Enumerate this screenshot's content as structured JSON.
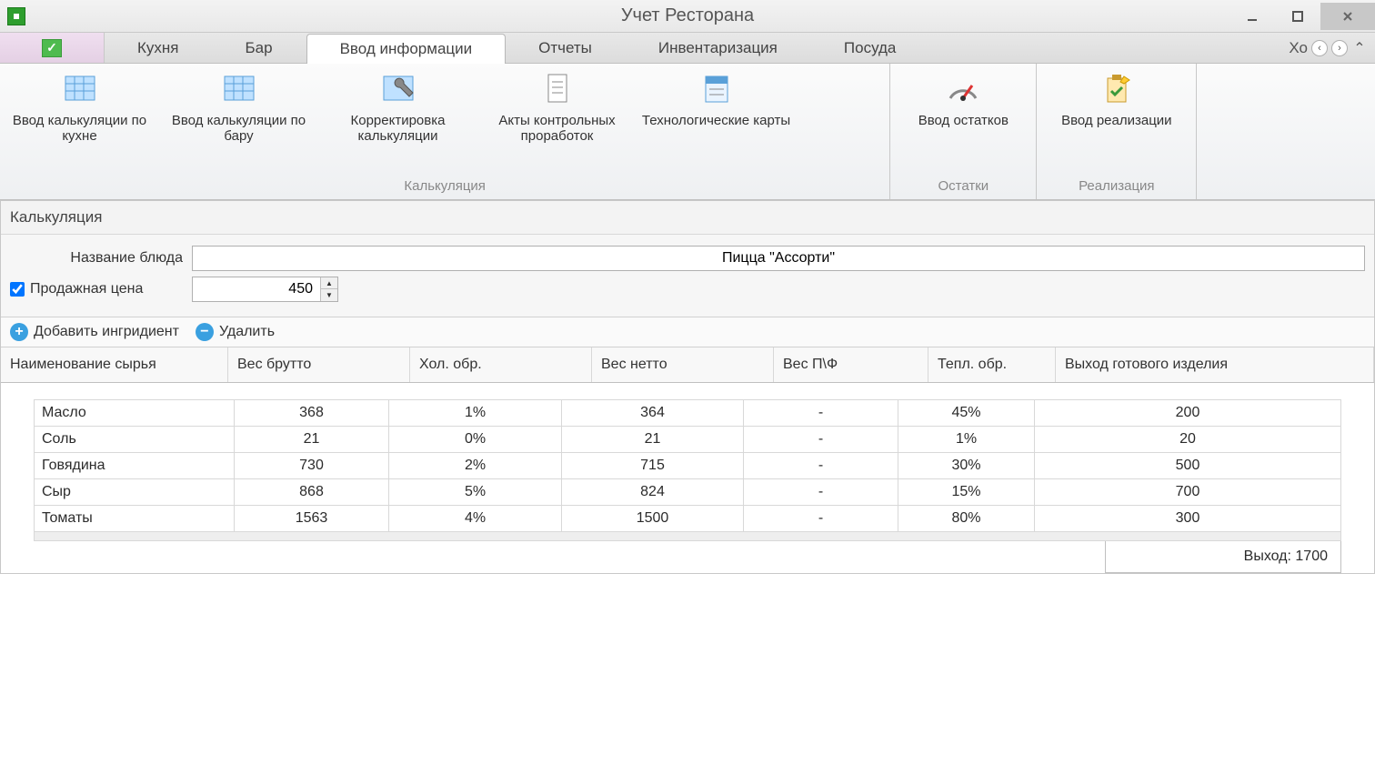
{
  "window": {
    "title": "Учет Ресторана"
  },
  "tabs": {
    "items": [
      "Кухня",
      "Бар",
      "Ввод информации",
      "Отчеты",
      "Инвентаризация",
      "Посуда"
    ],
    "overflow": "Хо"
  },
  "ribbon": {
    "group1": {
      "label": "Калькуляция",
      "items": [
        "Ввод калькуляции по кухне",
        "Ввод калькуляции по бару",
        "Корректировка калькуляции",
        "Акты контрольных проработок",
        "Технологические карты"
      ]
    },
    "group2": {
      "label": "Остатки",
      "item": "Ввод остатков"
    },
    "group3": {
      "label": "Реализация",
      "item": "Ввод реализации"
    }
  },
  "panel": {
    "title": "Калькуляция",
    "dish_label": "Название блюда",
    "dish_value": "Пицца \"Ассорти\"",
    "price_label": "Продажная цена",
    "price_value": "450"
  },
  "toolbar": {
    "add": "Добавить ингридиент",
    "del": "Удалить"
  },
  "grid": {
    "headers": [
      "Наименование сырья",
      "Вес брутто",
      "Хол. обр.",
      "Вес нетто",
      "Вес П\\Ф",
      "Тепл. обр.",
      "Выход готового изделия"
    ],
    "rows": [
      {
        "name": "Масло",
        "brutto": "368",
        "cold": "1%",
        "netto": "364",
        "pf": "-",
        "heat": "45%",
        "out": "200"
      },
      {
        "name": "Соль",
        "brutto": "21",
        "cold": "0%",
        "netto": "21",
        "pf": "-",
        "heat": "1%",
        "out": "20"
      },
      {
        "name": "Говядина",
        "brutto": "730",
        "cold": "2%",
        "netto": "715",
        "pf": "-",
        "heat": "30%",
        "out": "500"
      },
      {
        "name": "Сыр",
        "brutto": "868",
        "cold": "5%",
        "netto": "824",
        "pf": "-",
        "heat": "15%",
        "out": "700"
      },
      {
        "name": "Томаты",
        "brutto": "1563",
        "cold": "4%",
        "netto": "1500",
        "pf": "-",
        "heat": "80%",
        "out": "300"
      }
    ],
    "footer": "Выход: 1700"
  }
}
